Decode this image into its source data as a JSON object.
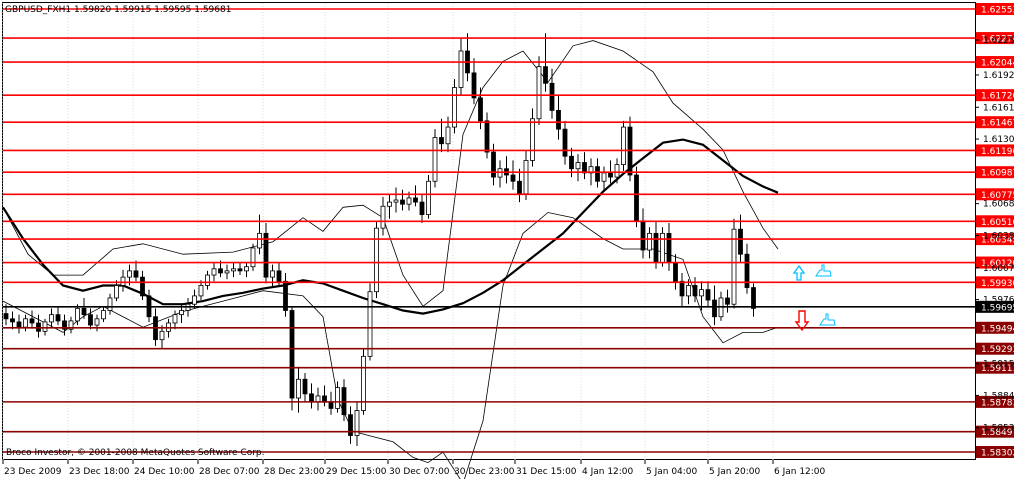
{
  "chart_data": {
    "type": "candlestick",
    "header": "GBPUSD_FXH1  1.59820 1.59915 1.59595 1.59681",
    "symbol": "GBPUSD_FX",
    "timeframe": "H1",
    "ohlc_current": {
      "open": 1.5982,
      "high": 1.59915,
      "low": 1.59595,
      "close": 1.59681
    },
    "copyright": "Broco Investor, © 2001-2008 MetaQuotes Software Corp.",
    "ylim": [
      1.5815,
      1.6265
    ],
    "x_ticks": [
      "23 Dec 2009",
      "23 Dec 18:00",
      "24 Dec 10:00",
      "28 Dec 07:00",
      "28 Dec 23:00",
      "29 Dec 15:00",
      "30 Dec 07:00",
      "30 Dec 23:00",
      "31 Dec 15:00",
      "4 Jan 12:00",
      "5 Jan 04:00",
      "5 Jan 20:00",
      "6 Jan 12:00"
    ],
    "y_ticks": [
      "1.62255",
      "1.61920",
      "1.61610",
      "1.61305",
      "1.60685",
      "1.60380",
      "1.60070",
      "1.59765",
      "1.59150",
      "1.58845",
      "1.58535"
    ],
    "level_lines": [
      {
        "value": "1.62553",
        "color": "#ff0000"
      },
      {
        "value": "1.62274",
        "color": "#ff0000"
      },
      {
        "value": "1.62044",
        "color": "#ff0000"
      },
      {
        "value": "1.61726",
        "color": "#ff0000"
      },
      {
        "value": "1.61467",
        "color": "#ff0000"
      },
      {
        "value": "1.61196",
        "color": "#ff0000"
      },
      {
        "value": "1.60987",
        "color": "#ff0000"
      },
      {
        "value": "1.60775",
        "color": "#ff0000"
      },
      {
        "value": "1.60516",
        "color": "#ff0000"
      },
      {
        "value": "1.60345",
        "color": "#ff0000"
      },
      {
        "value": "1.60120",
        "color": "#ff0000"
      },
      {
        "value": "1.59930",
        "color": "#ff0000"
      },
      {
        "value": "1.59695",
        "color": "#000000"
      },
      {
        "value": "1.59494",
        "color": "#8b0000"
      },
      {
        "value": "1.59293",
        "color": "#8b0000"
      },
      {
        "value": "1.59111",
        "color": "#8b0000"
      },
      {
        "value": "1.58783",
        "color": "#8b0000"
      },
      {
        "value": "1.58497",
        "color": "#8b0000"
      },
      {
        "value": "1.58302",
        "color": "#8b0000"
      }
    ],
    "ma": [
      [
        0,
        1.6065
      ],
      [
        20,
        1.6035
      ],
      [
        40,
        1.601
      ],
      [
        60,
        1.599
      ],
      [
        80,
        1.5985
      ],
      [
        100,
        1.599
      ],
      [
        120,
        1.599
      ],
      [
        140,
        1.5982
      ],
      [
        160,
        1.5972
      ],
      [
        180,
        1.5972
      ],
      [
        200,
        1.5975
      ],
      [
        220,
        1.598
      ],
      [
        240,
        1.5983
      ],
      [
        260,
        1.5987
      ],
      [
        280,
        1.599
      ],
      [
        300,
        1.5995
      ],
      [
        320,
        1.5992
      ],
      [
        340,
        1.5985
      ],
      [
        360,
        1.5978
      ],
      [
        380,
        1.5972
      ],
      [
        400,
        1.5966
      ],
      [
        420,
        1.5963
      ],
      [
        440,
        1.5967
      ],
      [
        460,
        1.5973
      ],
      [
        480,
        1.5983
      ],
      [
        500,
        1.5995
      ],
      [
        520,
        1.601
      ],
      [
        540,
        1.6025
      ],
      [
        560,
        1.604
      ],
      [
        580,
        1.606
      ],
      [
        600,
        1.608
      ],
      [
        620,
        1.6097
      ],
      [
        640,
        1.6112
      ],
      [
        660,
        1.6127
      ],
      [
        680,
        1.613
      ],
      [
        700,
        1.6125
      ],
      [
        720,
        1.611
      ],
      [
        740,
        1.6095
      ],
      [
        760,
        1.6085
      ],
      [
        775,
        1.6079
      ]
    ],
    "bollinger_upper": [
      [
        0,
        1.6065
      ],
      [
        25,
        1.602
      ],
      [
        50,
        1.6
      ],
      [
        80,
        1.6
      ],
      [
        110,
        1.6025
      ],
      [
        140,
        1.603
      ],
      [
        180,
        1.602
      ],
      [
        230,
        1.6022
      ],
      [
        270,
        1.6032
      ],
      [
        300,
        1.6055
      ],
      [
        320,
        1.6042
      ],
      [
        340,
        1.6065
      ],
      [
        360,
        1.6067
      ],
      [
        380,
        1.6055
      ],
      [
        400,
        1.6
      ],
      [
        420,
        1.597
      ],
      [
        440,
        1.5985
      ],
      [
        460,
        1.6135
      ],
      [
        480,
        1.618
      ],
      [
        500,
        1.6205
      ],
      [
        520,
        1.6215
      ],
      [
        545,
        1.6185
      ],
      [
        570,
        1.622
      ],
      [
        590,
        1.6225
      ],
      [
        620,
        1.6215
      ],
      [
        650,
        1.6195
      ],
      [
        670,
        1.6165
      ],
      [
        700,
        1.614
      ],
      [
        720,
        1.612
      ],
      [
        740,
        1.608
      ],
      [
        760,
        1.6045
      ],
      [
        775,
        1.6025
      ]
    ],
    "bollinger_lower": [
      [
        0,
        1.5975
      ],
      [
        20,
        1.5965
      ],
      [
        40,
        1.5955
      ],
      [
        60,
        1.5945
      ],
      [
        80,
        1.596
      ],
      [
        100,
        1.597
      ],
      [
        140,
        1.595
      ],
      [
        180,
        1.5965
      ],
      [
        220,
        1.5975
      ],
      [
        260,
        1.5985
      ],
      [
        300,
        1.598
      ],
      [
        320,
        1.596
      ],
      [
        335,
        1.588
      ],
      [
        350,
        1.585
      ],
      [
        370,
        1.5845
      ],
      [
        390,
        1.584
      ],
      [
        410,
        1.5825
      ],
      [
        425,
        1.582
      ],
      [
        440,
        1.583
      ],
      [
        460,
        1.58
      ],
      [
        480,
        1.586
      ],
      [
        500,
        1.599
      ],
      [
        520,
        1.604
      ],
      [
        545,
        1.606
      ],
      [
        570,
        1.6055
      ],
      [
        600,
        1.6035
      ],
      [
        620,
        1.6025
      ],
      [
        650,
        1.6025
      ],
      [
        680,
        1.6015
      ],
      [
        700,
        1.596
      ],
      [
        720,
        1.5935
      ],
      [
        740,
        1.5945
      ],
      [
        760,
        1.5945
      ],
      [
        775,
        1.595
      ]
    ],
    "candles": [
      [
        1.5963,
        1.5972,
        1.5952,
        1.5958
      ],
      [
        1.5958,
        1.5965,
        1.5948,
        1.5955
      ],
      [
        1.5955,
        1.5962,
        1.5944,
        1.595
      ],
      [
        1.595,
        1.5962,
        1.5946,
        1.5958
      ],
      [
        1.5958,
        1.5966,
        1.595,
        1.5954
      ],
      [
        1.5954,
        1.5962,
        1.594,
        1.5946
      ],
      [
        1.5946,
        1.5958,
        1.5942,
        1.5955
      ],
      [
        1.5955,
        1.5968,
        1.595,
        1.5962
      ],
      [
        1.5962,
        1.597,
        1.5952,
        1.5956
      ],
      [
        1.5956,
        1.5962,
        1.5942,
        1.5948
      ],
      [
        1.5948,
        1.596,
        1.5944,
        1.5956
      ],
      [
        1.5956,
        1.5972,
        1.5952,
        1.5968
      ],
      [
        1.5968,
        1.5978,
        1.5958,
        1.5962
      ],
      [
        1.5962,
        1.5968,
        1.5948,
        1.5952
      ],
      [
        1.5952,
        1.5962,
        1.5946,
        1.5958
      ],
      [
        1.5958,
        1.597,
        1.5955,
        1.5966
      ],
      [
        1.5966,
        1.5982,
        1.5962,
        1.5978
      ],
      [
        1.5978,
        1.5995,
        1.5975,
        1.599
      ],
      [
        1.599,
        1.6005,
        1.5984,
        1.5998
      ],
      [
        1.5998,
        1.601,
        1.599,
        1.6004
      ],
      [
        1.6004,
        1.6014,
        1.5994,
        1.5998
      ],
      [
        1.5998,
        1.6004,
        1.5976,
        1.598
      ],
      [
        1.598,
        1.5986,
        1.5955,
        1.596
      ],
      [
        1.596,
        1.5968,
        1.5932,
        1.5938
      ],
      [
        1.5938,
        1.5952,
        1.593,
        1.5946
      ],
      [
        1.5946,
        1.5958,
        1.594,
        1.5954
      ],
      [
        1.5954,
        1.5966,
        1.5948,
        1.5962
      ],
      [
        1.5962,
        1.5972,
        1.5954,
        1.5966
      ],
      [
        1.5966,
        1.5978,
        1.596,
        1.5972
      ],
      [
        1.5972,
        1.5986,
        1.5968,
        1.598
      ],
      [
        1.598,
        1.5995,
        1.5976,
        1.599
      ],
      [
        1.599,
        1.6004,
        1.5986,
        1.6
      ],
      [
        1.6,
        1.6012,
        1.5994,
        1.6006
      ],
      [
        1.6006,
        1.6014,
        1.5998,
        1.6002
      ],
      [
        1.6002,
        1.601,
        1.5996,
        1.6004
      ],
      [
        1.6004,
        1.6012,
        1.5998,
        1.6006
      ],
      [
        1.6006,
        1.6012,
        1.6,
        1.6004
      ],
      [
        1.6004,
        1.6012,
        1.5998,
        1.6008
      ],
      [
        1.6008,
        1.603,
        1.6004,
        1.6026
      ],
      [
        1.6026,
        1.6058,
        1.602,
        1.604
      ],
      [
        1.604,
        1.605,
        1.5992,
        1.5998
      ],
      [
        1.5998,
        1.601,
        1.5988,
        1.6004
      ],
      [
        1.6004,
        1.6012,
        1.599,
        1.5994
      ],
      [
        1.5994,
        1.6002,
        1.596,
        1.5966
      ],
      [
        1.5966,
        1.597,
        1.587,
        1.5882
      ],
      [
        1.5882,
        1.5912,
        1.5868,
        1.59
      ],
      [
        1.59,
        1.5906,
        1.5878,
        1.5886
      ],
      [
        1.5886,
        1.5896,
        1.5872,
        1.5878
      ],
      [
        1.5878,
        1.5892,
        1.587,
        1.5884
      ],
      [
        1.5884,
        1.5894,
        1.5874,
        1.5878
      ],
      [
        1.5878,
        1.5888,
        1.5866,
        1.5872
      ],
      [
        1.5872,
        1.5898,
        1.5868,
        1.5892
      ],
      [
        1.5892,
        1.59,
        1.586,
        1.5866
      ],
      [
        1.5866,
        1.5874,
        1.5838,
        1.5846
      ],
      [
        1.5846,
        1.5878,
        1.5836,
        1.587
      ],
      [
        1.587,
        1.593,
        1.5866,
        1.5922
      ],
      [
        1.5922,
        1.5992,
        1.5918,
        1.5984
      ],
      [
        1.5984,
        1.6052,
        1.5978,
        1.6045
      ],
      [
        1.6045,
        1.6075,
        1.6038,
        1.6066
      ],
      [
        1.6066,
        1.6078,
        1.6054,
        1.607
      ],
      [
        1.607,
        1.6084,
        1.606,
        1.6072
      ],
      [
        1.6072,
        1.6082,
        1.6062,
        1.6068
      ],
      [
        1.6068,
        1.608,
        1.6062,
        1.6074
      ],
      [
        1.6074,
        1.6086,
        1.6066,
        1.607
      ],
      [
        1.607,
        1.6078,
        1.605,
        1.6058
      ],
      [
        1.6058,
        1.6096,
        1.6054,
        1.609
      ],
      [
        1.609,
        1.614,
        1.6084,
        1.6132
      ],
      [
        1.6132,
        1.615,
        1.6118,
        1.6126
      ],
      [
        1.6126,
        1.6152,
        1.6118,
        1.6142
      ],
      [
        1.6142,
        1.6188,
        1.6136,
        1.618
      ],
      [
        1.618,
        1.6228,
        1.6172,
        1.6215
      ],
      [
        1.6215,
        1.6232,
        1.6186,
        1.6194
      ],
      [
        1.6194,
        1.6208,
        1.6164,
        1.617
      ],
      [
        1.617,
        1.618,
        1.614,
        1.6148
      ],
      [
        1.6148,
        1.6156,
        1.6112,
        1.6118
      ],
      [
        1.6118,
        1.6126,
        1.6086,
        1.6094
      ],
      [
        1.6094,
        1.611,
        1.6084,
        1.6102
      ],
      [
        1.6102,
        1.6114,
        1.6088,
        1.6096
      ],
      [
        1.6096,
        1.611,
        1.6082,
        1.609
      ],
      [
        1.609,
        1.6102,
        1.607,
        1.6078
      ],
      [
        1.6078,
        1.612,
        1.6072,
        1.611
      ],
      [
        1.611,
        1.616,
        1.6104,
        1.615
      ],
      [
        1.615,
        1.621,
        1.6144,
        1.62
      ],
      [
        1.62,
        1.6232,
        1.6176,
        1.6184
      ],
      [
        1.6184,
        1.6198,
        1.615,
        1.6158
      ],
      [
        1.6158,
        1.6172,
        1.613,
        1.614
      ],
      [
        1.614,
        1.6148,
        1.6106,
        1.6114
      ],
      [
        1.6114,
        1.6122,
        1.6094,
        1.6102
      ],
      [
        1.6102,
        1.6116,
        1.609,
        1.6108
      ],
      [
        1.6108,
        1.6118,
        1.6092,
        1.6098
      ],
      [
        1.6098,
        1.6112,
        1.6086,
        1.6104
      ],
      [
        1.6104,
        1.6112,
        1.6084,
        1.609
      ],
      [
        1.609,
        1.6104,
        1.608,
        1.6098
      ],
      [
        1.6098,
        1.611,
        1.6088,
        1.6094
      ],
      [
        1.6094,
        1.6112,
        1.6088,
        1.6106
      ],
      [
        1.6106,
        1.6148,
        1.61,
        1.6142
      ],
      [
        1.6142,
        1.6152,
        1.609,
        1.6096
      ],
      [
        1.6096,
        1.6104,
        1.6046,
        1.6052
      ],
      [
        1.6052,
        1.6064,
        1.6016,
        1.6024
      ],
      [
        1.6024,
        1.6046,
        1.6016,
        1.604
      ],
      [
        1.604,
        1.6052,
        1.6006,
        1.6012
      ],
      [
        1.6012,
        1.6046,
        1.6008,
        1.604
      ],
      [
        1.604,
        1.605,
        1.6004,
        1.6012
      ],
      [
        1.6012,
        1.602,
        1.5986,
        1.5994
      ],
      [
        1.5994,
        1.6002,
        1.597,
        1.598
      ],
      [
        1.598,
        1.5996,
        1.5972,
        1.599
      ],
      [
        1.599,
        1.5998,
        1.5974,
        1.598
      ],
      [
        1.598,
        1.5994,
        1.5966,
        1.5986
      ],
      [
        1.5986,
        1.5994,
        1.597,
        1.5976
      ],
      [
        1.5976,
        1.599,
        1.5952,
        1.596
      ],
      [
        1.596,
        1.5984,
        1.5956,
        1.5978
      ],
      [
        1.5978,
        1.5986,
        1.5964,
        1.5972
      ],
      [
        1.5972,
        1.6054,
        1.5968,
        1.6044
      ],
      [
        1.6044,
        1.6058,
        1.6012,
        1.602
      ],
      [
        1.602,
        1.603,
        1.5982,
        1.5988
      ],
      [
        1.5988,
        1.5992,
        1.596,
        1.5968
      ]
    ],
    "signal_up": {
      "arrow_color": "#00bfff",
      "hand_color": "#00bfff"
    },
    "signal_down": {
      "arrow_color": "#ff0000",
      "hand_color": "#00bfff"
    }
  }
}
